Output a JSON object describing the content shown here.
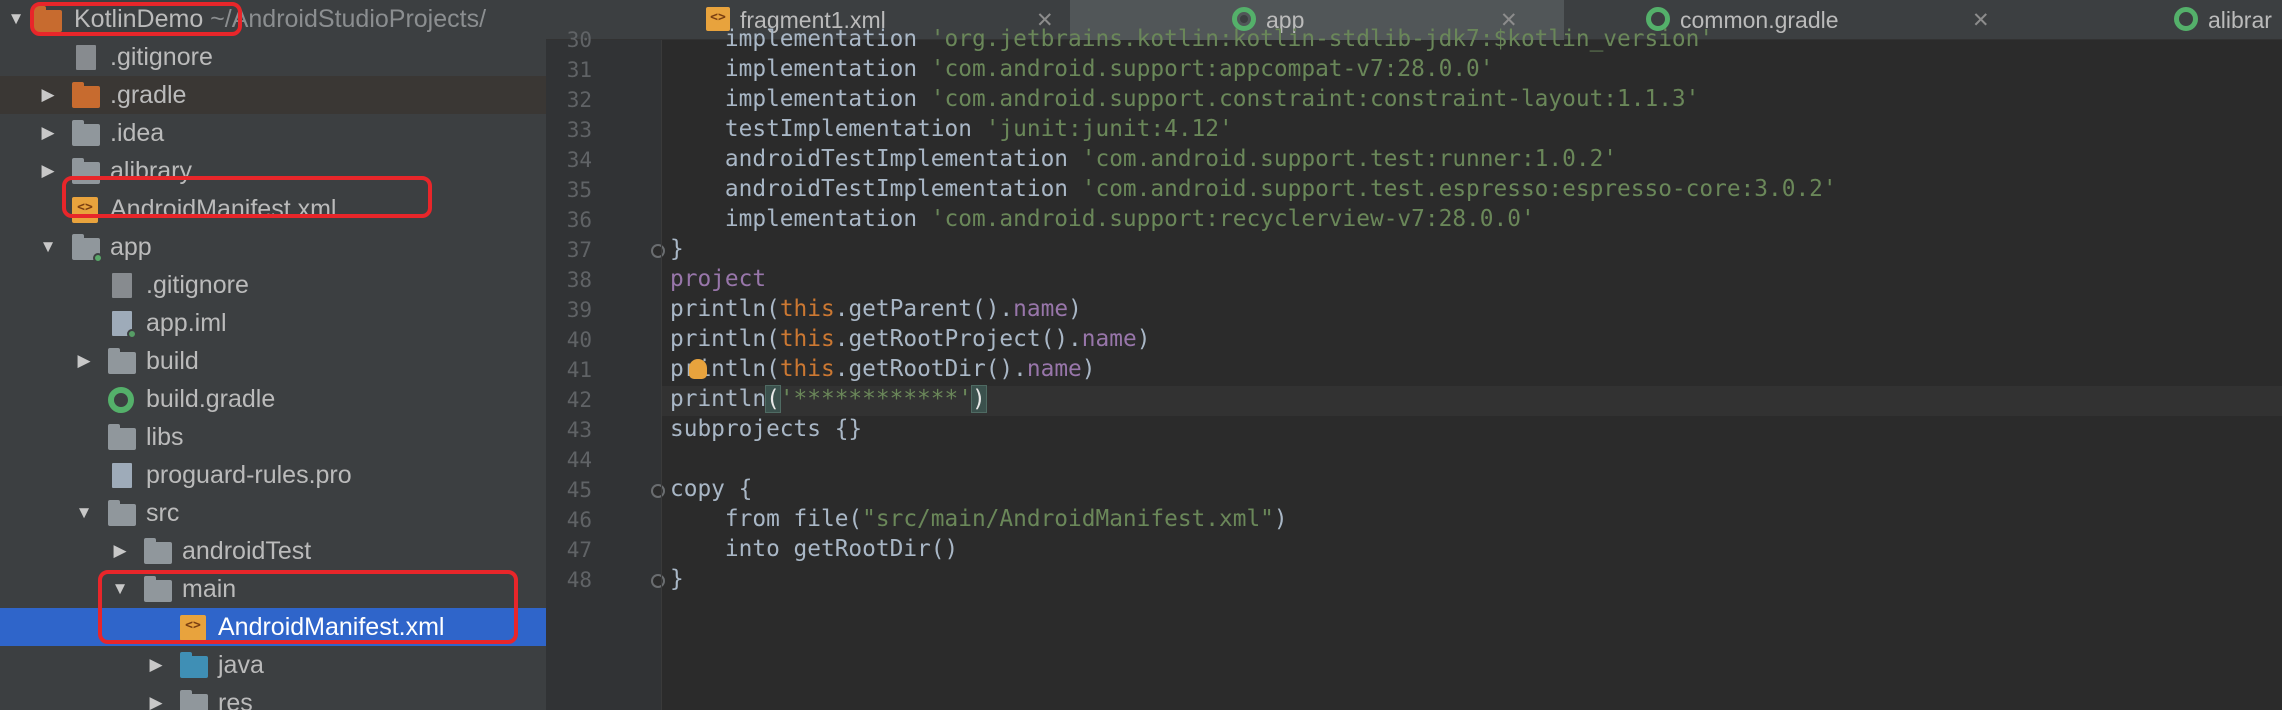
{
  "project_tree": {
    "items": [
      {
        "name": "KotlinDemo",
        "suffix": "~/AndroidStudioProjects/",
        "kind": "project"
      },
      {
        "name": ".gitignore"
      },
      {
        "name": ".gradle"
      },
      {
        "name": ".idea"
      },
      {
        "name": "alibrary"
      },
      {
        "name": "AndroidManifest.xml"
      },
      {
        "name": "app"
      },
      {
        "name": ".gitignore"
      },
      {
        "name": "app.iml"
      },
      {
        "name": "build"
      },
      {
        "name": "build.gradle"
      },
      {
        "name": "libs"
      },
      {
        "name": "proguard-rules.pro"
      },
      {
        "name": "src"
      },
      {
        "name": "androidTest"
      },
      {
        "name": "main"
      },
      {
        "name": "AndroidManifest.xml"
      },
      {
        "name": "java"
      },
      {
        "name": "res"
      }
    ],
    "selected_index": 16
  },
  "tabs": [
    {
      "label": "fragment1.xml",
      "icon": "xml-file-icon"
    },
    {
      "label": "app",
      "icon": "gradle-icon"
    },
    {
      "label": "common.gradle",
      "icon": "gradle-icon"
    },
    {
      "label": "alibrar",
      "icon": "gradle-icon"
    }
  ],
  "active_tab": 1,
  "editor": {
    "line_numbers": [
      "30",
      "31",
      "32",
      "33",
      "34",
      "35",
      "36",
      "37",
      "38",
      "39",
      "40",
      "41",
      "42",
      "43",
      "44",
      "45",
      "46",
      "47",
      "48"
    ],
    "lines": [
      [
        {
          "t": "    implementation "
        },
        {
          "t": "'org.jetbrains.kotlin:kotlin-stdlib-jdk7:$kotlin_version'",
          "c": "str"
        }
      ],
      [
        {
          "t": "    implementation "
        },
        {
          "t": "'com.android.support:appcompat-v7:28.0.0'",
          "c": "str"
        }
      ],
      [
        {
          "t": "    implementation "
        },
        {
          "t": "'com.android.support.constraint:constraint-layout:1.1.3'",
          "c": "str"
        }
      ],
      [
        {
          "t": "    testImplementation "
        },
        {
          "t": "'junit:junit:4.12'",
          "c": "str"
        }
      ],
      [
        {
          "t": "    androidTestImplementation "
        },
        {
          "t": "'com.android.support.test:runner:1.0.2'",
          "c": "str"
        }
      ],
      [
        {
          "t": "    androidTestImplementation "
        },
        {
          "t": "'com.android.support.test.espresso:espresso-core:3.0.2'",
          "c": "str"
        }
      ],
      [
        {
          "t": "    implementation "
        },
        {
          "t": "'com.android.support:recyclerview-v7:28.0.0'",
          "c": "str"
        }
      ],
      [
        {
          "t": "}"
        }
      ],
      [
        {
          "t": "project",
          "c": "prop"
        }
      ],
      [
        {
          "t": "println("
        },
        {
          "t": "this",
          "c": "this"
        },
        {
          "t": ".getParent()."
        },
        {
          "t": "name",
          "c": "prop"
        },
        {
          "t": ")"
        }
      ],
      [
        {
          "t": "println("
        },
        {
          "t": "this",
          "c": "this"
        },
        {
          "t": ".getRootProject()."
        },
        {
          "t": "name",
          "c": "prop"
        },
        {
          "t": ")"
        }
      ],
      [
        {
          "t": "println("
        },
        {
          "t": "this",
          "c": "this"
        },
        {
          "t": ".getRootDir()."
        },
        {
          "t": "name",
          "c": "prop"
        },
        {
          "t": ")"
        }
      ],
      [
        {
          "t": "println"
        },
        {
          "t": "(",
          "c": "brk"
        },
        {
          "t": "'************'",
          "c": "str"
        },
        {
          "t": ")",
          "c": "brk"
        }
      ],
      [
        {
          "t": "subprojects {}"
        }
      ],
      [
        {
          "t": ""
        }
      ],
      [
        {
          "t": "copy {"
        }
      ],
      [
        {
          "t": "    from file("
        },
        {
          "t": "\"src/main/AndroidManifest.xml\"",
          "c": "str"
        },
        {
          "t": ")"
        }
      ],
      [
        {
          "t": "    into getRootDir()"
        }
      ],
      [
        {
          "t": "}"
        }
      ]
    ],
    "current_line_index": 12
  },
  "colors": {
    "selection": "#2f65ca",
    "annotation_box": "#e8262a",
    "string": "#6a8759",
    "keyword": "#cc7832",
    "property": "#9876aa"
  }
}
